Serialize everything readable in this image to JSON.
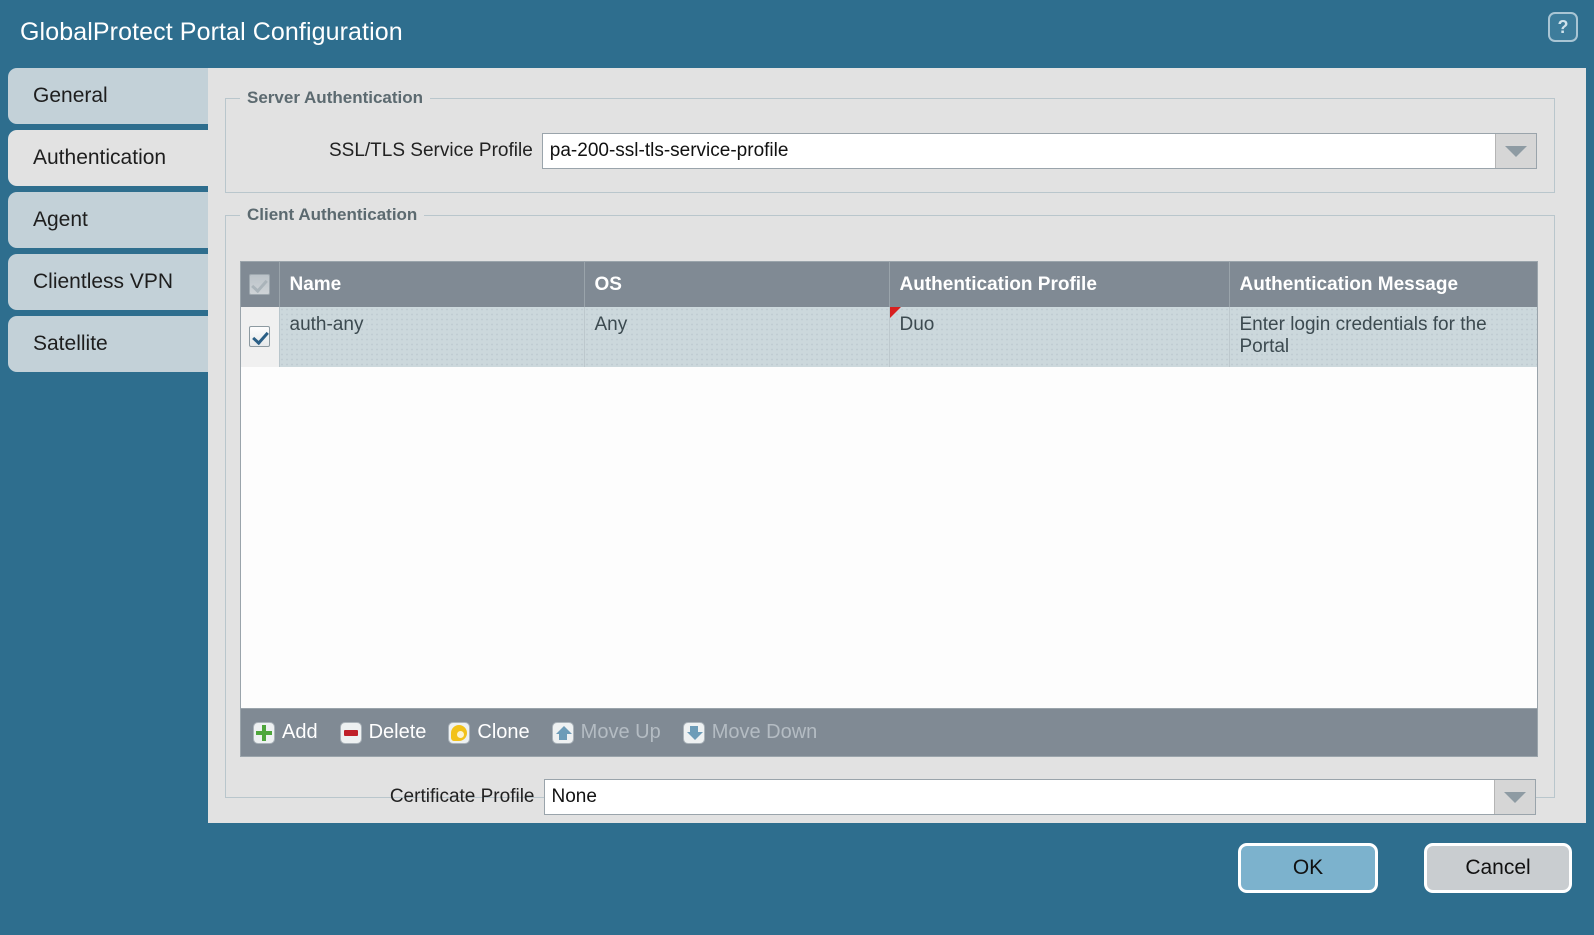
{
  "window": {
    "title": "GlobalProtect Portal Configuration",
    "help_icon": "help-question-icon",
    "accent_color": "#2e6e8e"
  },
  "tabs": [
    {
      "label": "General",
      "active": false
    },
    {
      "label": "Authentication",
      "active": true
    },
    {
      "label": "Agent",
      "active": false
    },
    {
      "label": "Clientless VPN",
      "active": false
    },
    {
      "label": "Satellite",
      "active": false
    }
  ],
  "server_authentication": {
    "legend": "Server Authentication",
    "ssl_tls_service_profile": {
      "label": "SSL/TLS Service Profile",
      "value": "pa-200-ssl-tls-service-profile"
    }
  },
  "client_authentication": {
    "legend": "Client Authentication",
    "table": {
      "columns": [
        "Name",
        "OS",
        "Authentication Profile",
        "Authentication Message"
      ],
      "rows": [
        {
          "checked": true,
          "name": "auth-any",
          "os": "Any",
          "authentication_profile": "Duo",
          "authentication_profile_modified": true,
          "authentication_message": "Enter login credentials for the Portal"
        }
      ]
    },
    "toolbar": [
      {
        "label": "Add",
        "icon": "plus-icon",
        "enabled": true
      },
      {
        "label": "Delete",
        "icon": "minus-icon",
        "enabled": true
      },
      {
        "label": "Clone",
        "icon": "clone-icon",
        "enabled": true
      },
      {
        "label": "Move Up",
        "icon": "arrow-up-icon",
        "enabled": false
      },
      {
        "label": "Move Down",
        "icon": "arrow-down-icon",
        "enabled": false
      }
    ],
    "certificate_profile": {
      "label": "Certificate Profile",
      "value": "None"
    }
  },
  "footer": {
    "ok_label": "OK",
    "cancel_label": "Cancel"
  }
}
